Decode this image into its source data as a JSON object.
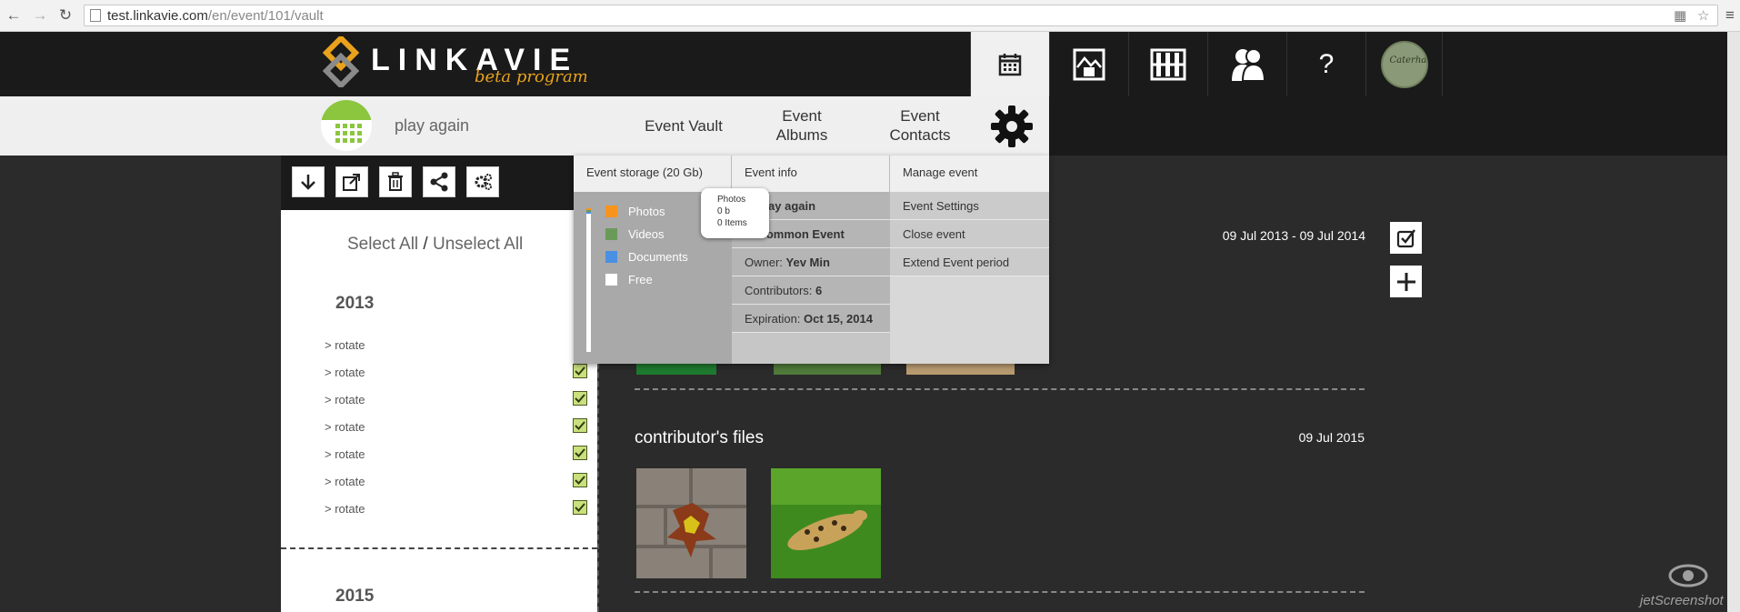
{
  "browser": {
    "url_host": "test.linkavie.com",
    "url_path": "/en/event/101/vault"
  },
  "brand": {
    "logo_word": "LINKAVIE",
    "logo_sub": "beta program",
    "accent": "#e8a21c"
  },
  "top_nav": {
    "help_label": "?",
    "avatar_text": "Caterham Glass Gr"
  },
  "event": {
    "name": "play again",
    "nav": [
      {
        "label": "Event Vault"
      },
      {
        "label": "Event\nAlbums"
      },
      {
        "label": "Event\nContacts"
      }
    ]
  },
  "left": {
    "select_all": "Select All",
    "separator": " / ",
    "unselect_all": "Unselect All",
    "years": [
      "2013",
      "2015"
    ],
    "items": [
      {
        "label": "> rotate",
        "checked": true
      },
      {
        "label": "> rotate",
        "checked": true
      },
      {
        "label": "> rotate",
        "checked": true
      },
      {
        "label": "> rotate",
        "checked": true
      },
      {
        "label": "> rotate",
        "checked": true
      },
      {
        "label": "> rotate",
        "checked": true
      },
      {
        "label": "> rotate",
        "checked": true
      }
    ]
  },
  "main": {
    "date_range": "09 Jul 2013 - 09 Jul 2014",
    "section_title": "contributor's files",
    "section_date": "09 Jul 2015"
  },
  "dropdown": {
    "storage_header": "Event storage (20 Gb)",
    "info_header": "Event info",
    "manage_header": "Manage event",
    "legend": [
      {
        "label": "Photos",
        "color": "#f7941d"
      },
      {
        "label": "Videos",
        "color": "#6a9a5a"
      },
      {
        "label": "Documents",
        "color": "#4a90e2"
      },
      {
        "label": "Free",
        "color": "#ffffff"
      }
    ],
    "info_rows": [
      {
        "key": "e: ",
        "value": "play again"
      },
      {
        "key": "e: ",
        "value": "Common Event"
      },
      {
        "key": "Owner: ",
        "value": "Yev Min"
      },
      {
        "key": "Contributors: ",
        "value": "6"
      },
      {
        "key": "Expiration: ",
        "value": "Oct 15, 2014"
      }
    ],
    "manage_rows": [
      "Event Settings",
      "Close event",
      "Extend Event period"
    ],
    "tooltip": {
      "title": "Photos",
      "size": "0 b",
      "count": "0 Items"
    }
  },
  "watermark": "jetScreenshot"
}
